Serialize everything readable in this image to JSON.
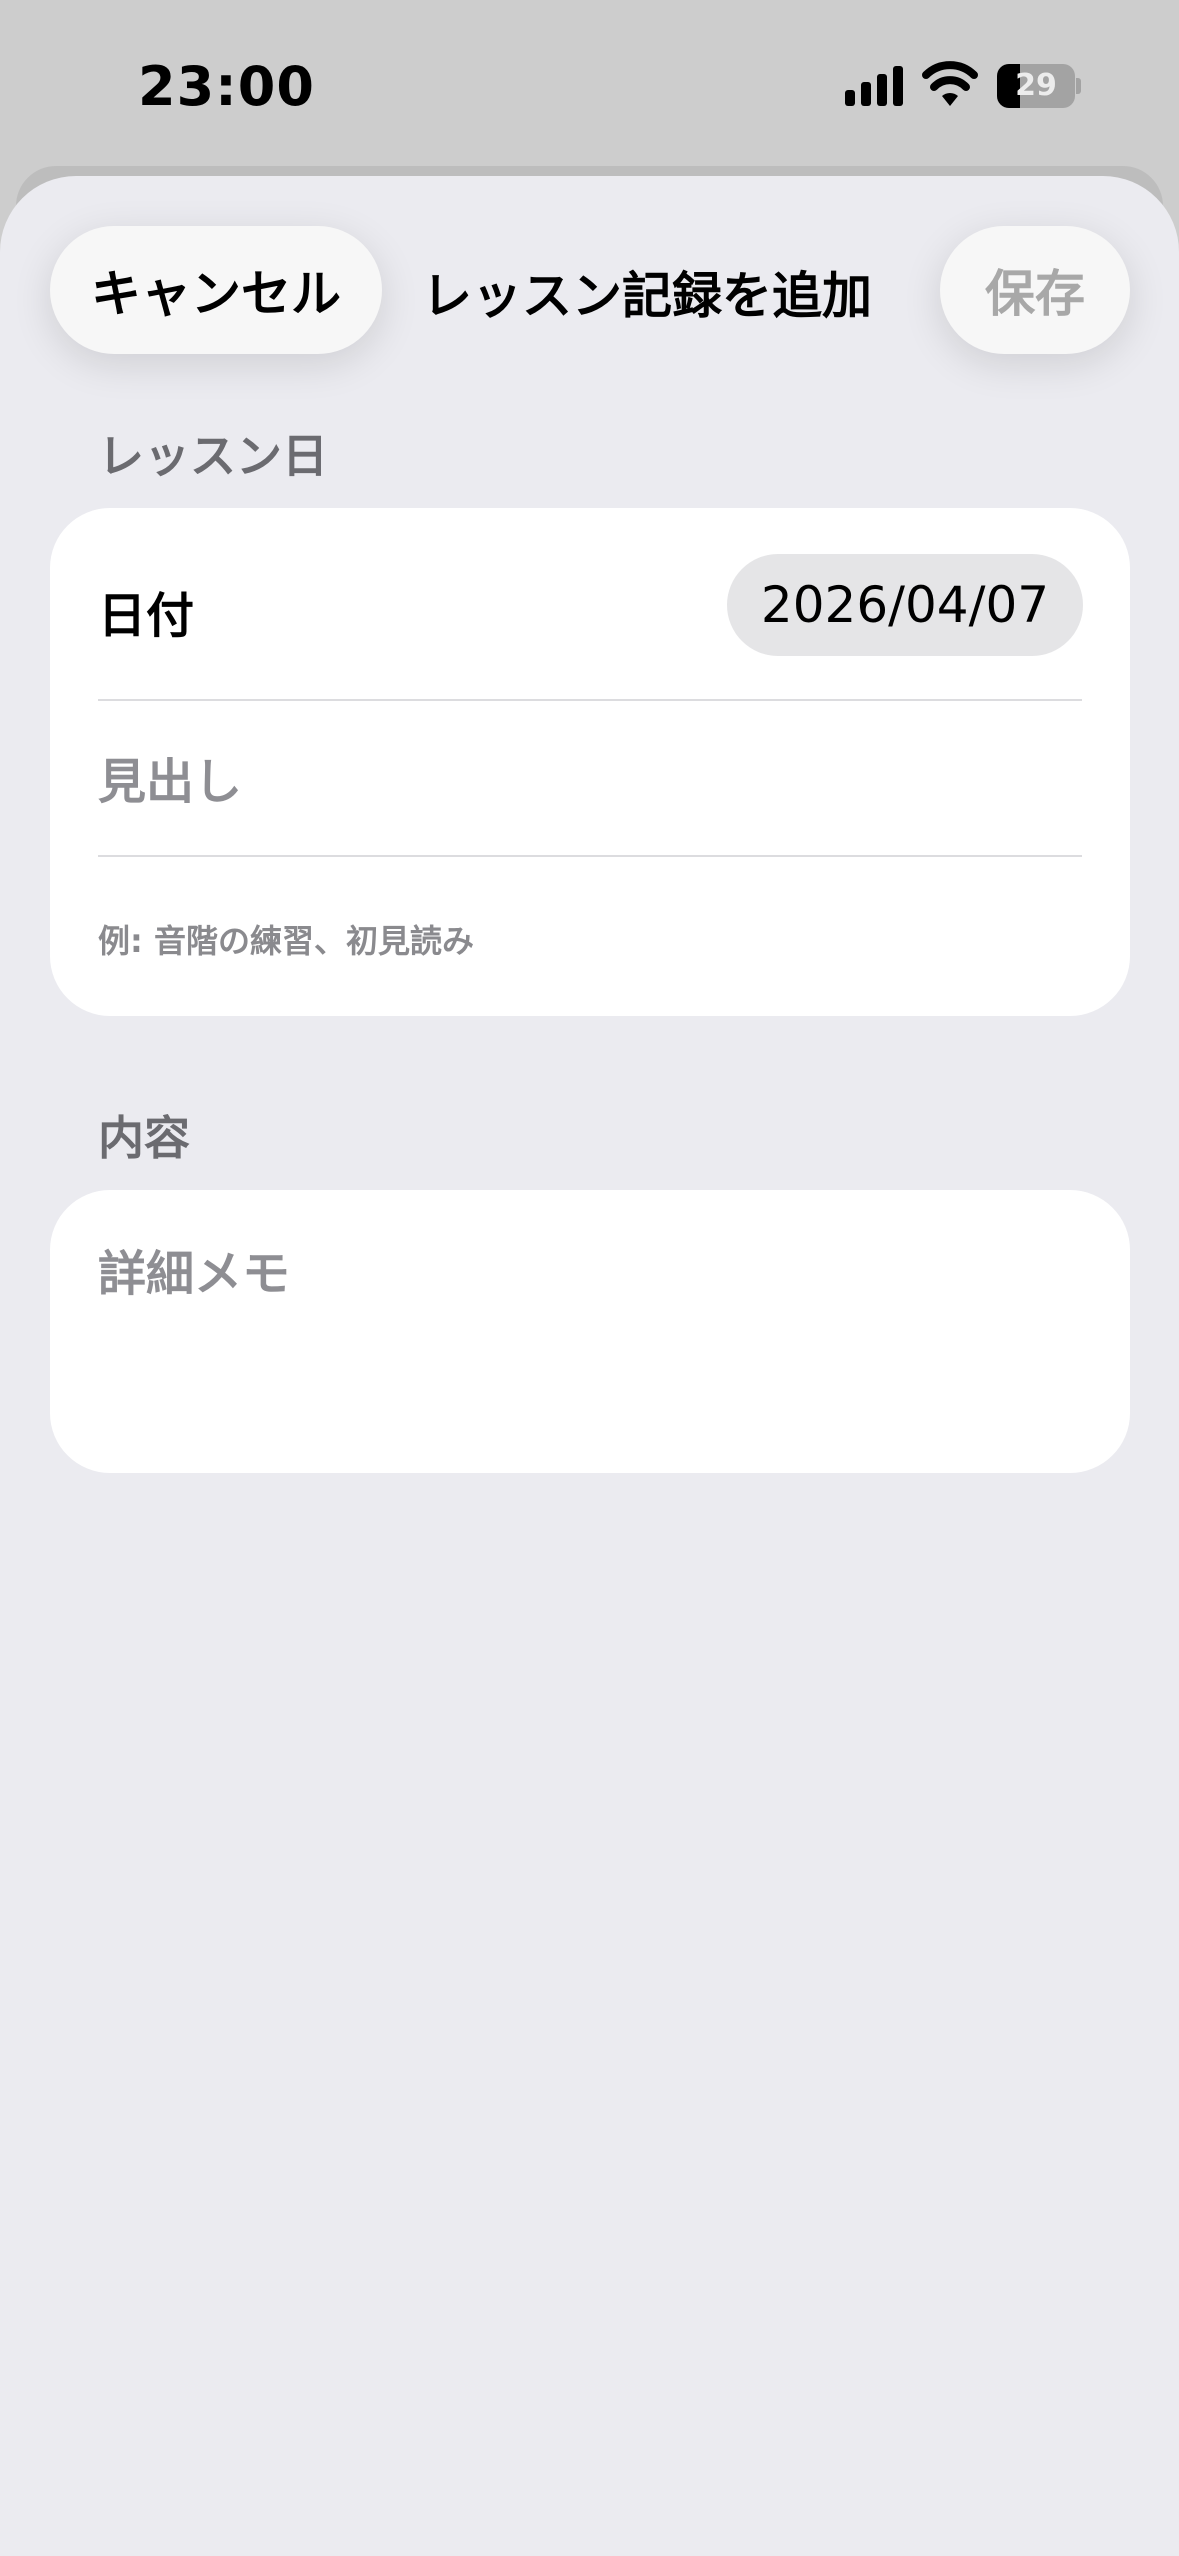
{
  "status_bar": {
    "time": "23:00",
    "battery_level": "29",
    "icons": [
      "cellular-signal-icon",
      "wifi-icon",
      "battery-icon"
    ]
  },
  "nav": {
    "cancel_label": "キャンセル",
    "title": "レッスン記録を追加",
    "save_label": "保存"
  },
  "lesson_day_section": {
    "header": "レッスン日",
    "date_label": "日付",
    "date_value": "2026/04/07",
    "headline_placeholder": "見出し",
    "headline_value": "",
    "headline_hint": "例: 音階の練習、初見読み"
  },
  "content_section": {
    "header": "内容",
    "memo_placeholder": "詳細メモ",
    "memo_value": ""
  },
  "colors": {
    "sheet_background": "#ebebf0",
    "card_background": "#ffffff",
    "secondary_text": "#8e8e93",
    "disabled_text": "#a8a8a8"
  }
}
